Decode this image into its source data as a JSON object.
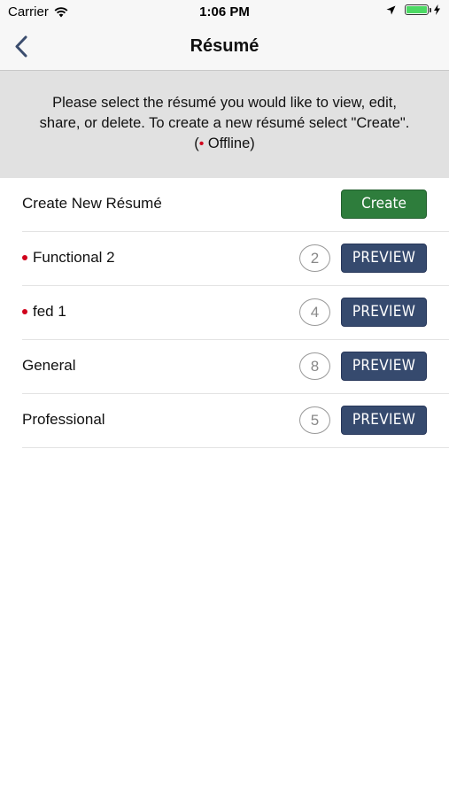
{
  "status_bar": {
    "carrier": "Carrier",
    "time": "1:06 PM",
    "battery_level": 1.0
  },
  "nav": {
    "title": "Résumé",
    "back_icon": "chevron-left-icon"
  },
  "instructions": {
    "line1": "Please select the résumé you would like to view, edit,",
    "line2": "share, or delete. To create a new résumé select \"Create\".",
    "legend_open": "(",
    "legend_dot": "•",
    "legend_text": " Offline)"
  },
  "create_row": {
    "label": "Create New Résumé",
    "button_label": "Create"
  },
  "resumes": [
    {
      "name": "Functional 2",
      "count": "2",
      "button_label": "PREVIEW",
      "offline": true
    },
    {
      "name": "fed 1",
      "count": "4",
      "button_label": "PREVIEW",
      "offline": true
    },
    {
      "name": "General",
      "count": "8",
      "button_label": "PREVIEW",
      "offline": false
    },
    {
      "name": "Professional",
      "count": "5",
      "button_label": "PREVIEW",
      "offline": false
    }
  ],
  "colors": {
    "accent_green": "#2e7d3c",
    "preview_blue": "#364a6e",
    "offline_red": "#d0021b",
    "battery_green": "#4cd964"
  }
}
